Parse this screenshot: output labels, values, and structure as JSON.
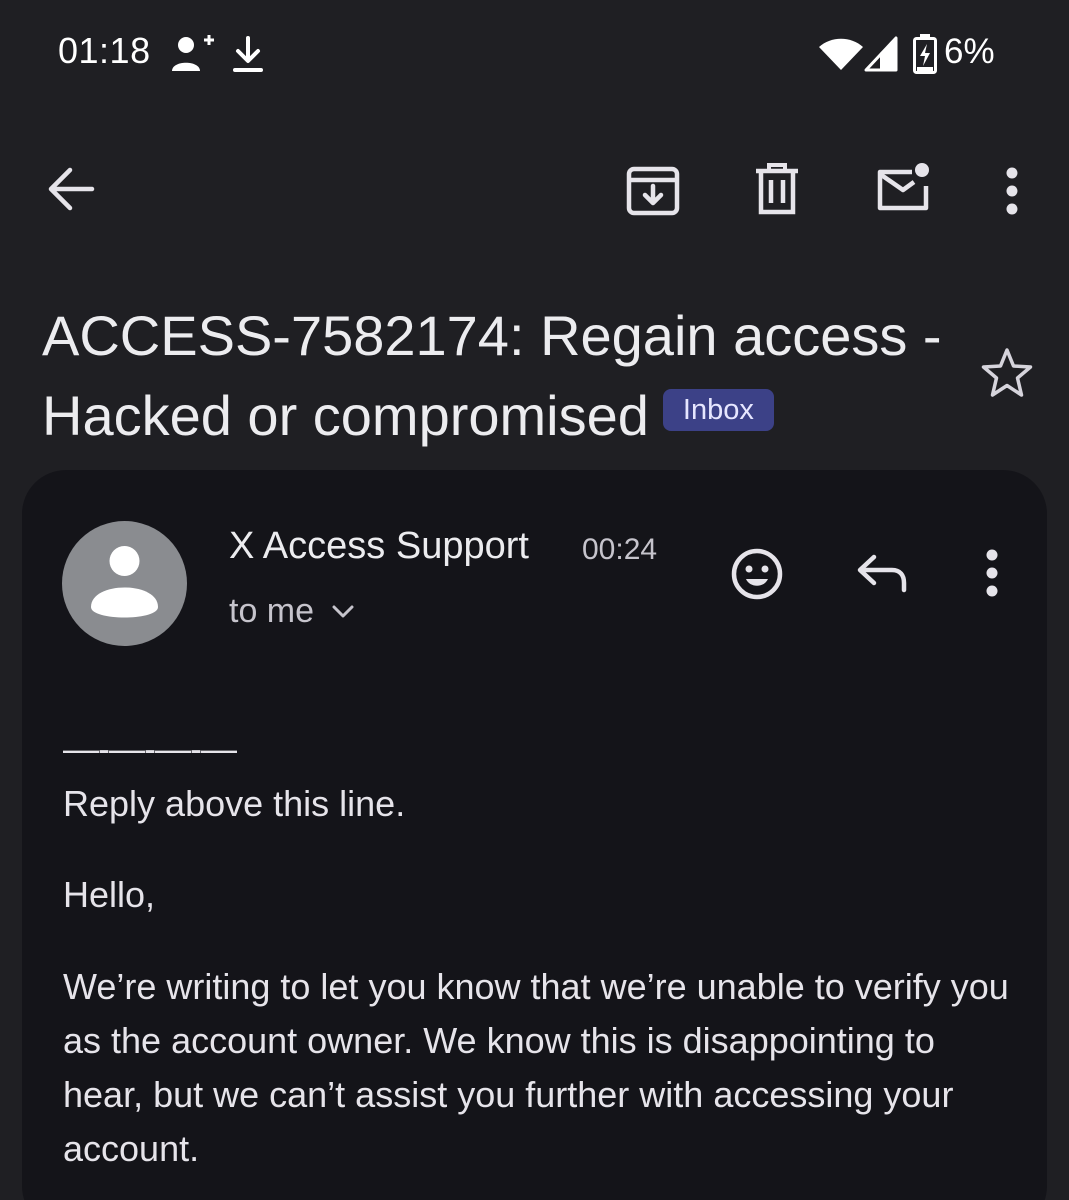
{
  "status_bar": {
    "time": "01:18",
    "left_icons": [
      "person-add-icon",
      "download-icon"
    ],
    "right_icons": [
      "wifi-icon",
      "cell-signal-icon",
      "battery-charging-icon"
    ],
    "battery_percent": "6%"
  },
  "toolbar": {
    "back_icon": "arrow-left-icon",
    "actions": [
      "archive-icon",
      "delete-icon",
      "mark-unread-icon",
      "more-vert-icon"
    ]
  },
  "email": {
    "subject": "ACCESS-7582174: Regain access - Hacked or compromised",
    "label": "Inbox",
    "sender_name": "X Access Support",
    "time": "00:24",
    "recipient": "to me",
    "body": {
      "separator": "—-—-—-—",
      "reply_line": "Reply above this line.",
      "greeting": "Hello,",
      "paragraph": "We’re writing to let you know that we’re unable to verify you as the account owner. We know this is disappointing to hear, but we can’t assist you further with accessing your account."
    }
  },
  "colors": {
    "background": "#1f1f23",
    "card": "#141419",
    "badge": "#3c4187",
    "avatar": "#8a8c90"
  }
}
